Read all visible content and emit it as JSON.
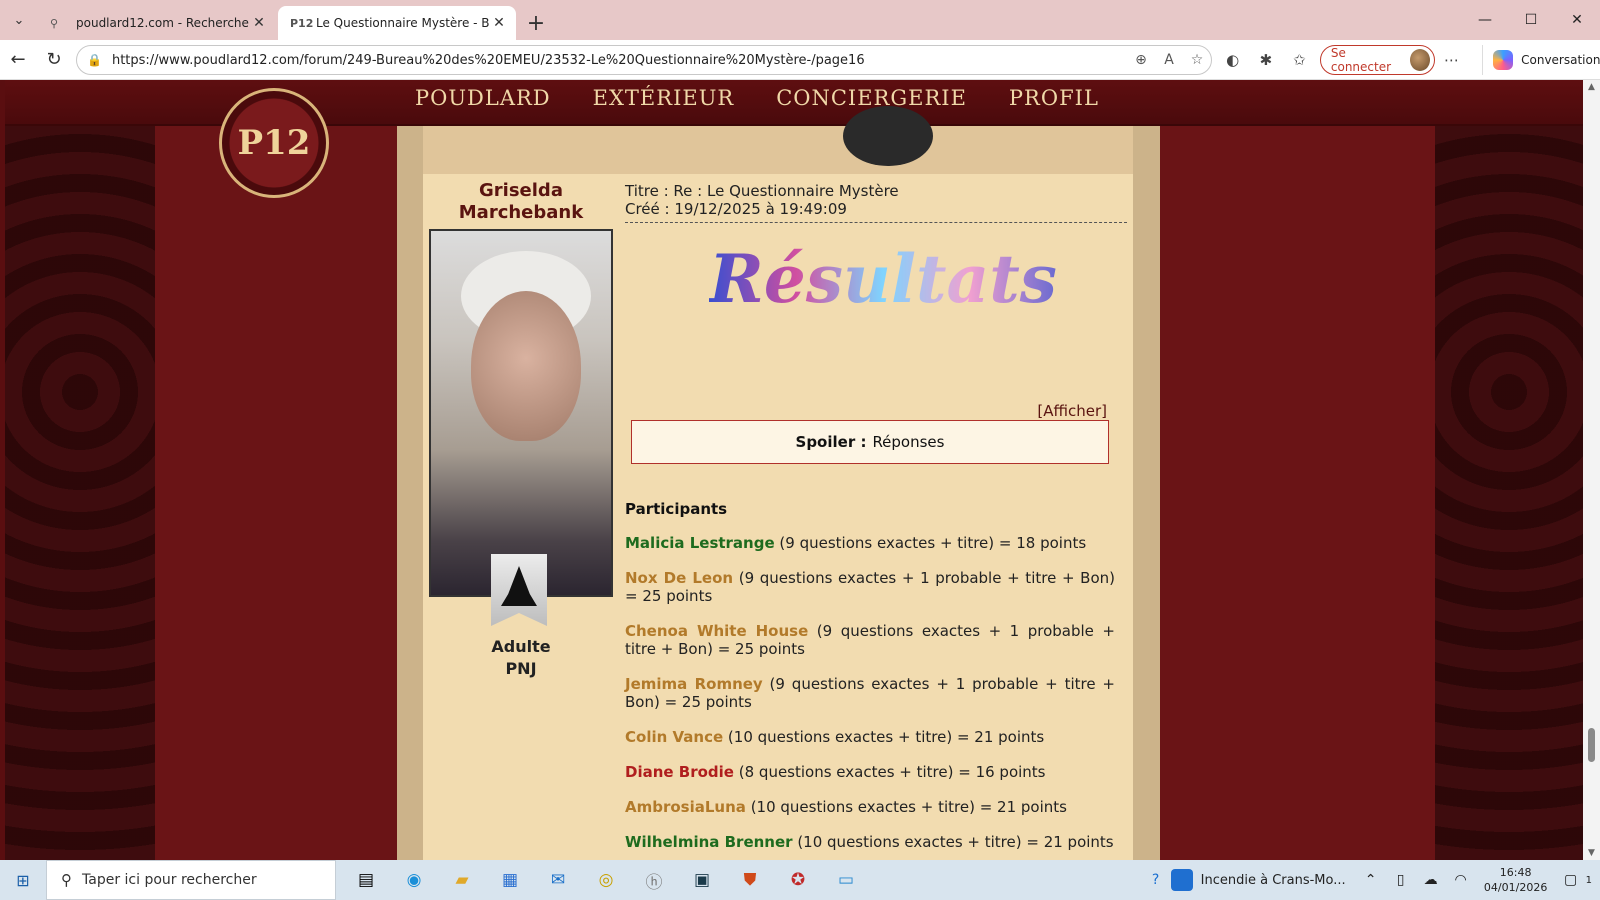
{
  "browser": {
    "tabs": [
      {
        "title": "poudlard12.com - Recherche",
        "active": false,
        "favicon": "search-icon"
      },
      {
        "title": "Le Questionnaire Mystère - Bureau",
        "active": true,
        "favicon_text": "P12"
      }
    ],
    "url": "https://www.poudlard12.com/forum/249-Bureau%20des%20EMEU/23532-Le%20Questionnaire%20Mystère-/page16",
    "login_label": "Se connecter",
    "conversation_label": "Conversation"
  },
  "site": {
    "logo_text": "P12",
    "nav": [
      "POUDLARD",
      "EXTÉRIEUR",
      "CONCIERGERIE",
      "PROFIL"
    ]
  },
  "post": {
    "author_name": "Griselda Marchebank",
    "role_line1": "Adulte",
    "role_line2": "PNJ",
    "title_line": "Titre : Re : Le Questionnaire Mystère",
    "created_line": "Créé : 19/12/2025 à 19:49:09",
    "banner": "Résultats",
    "afficher": "[Afficher]",
    "spoiler_label": "Spoiler :",
    "spoiler_text": "Réponses",
    "participants_title": "Participants",
    "entries": [
      {
        "name": "Malicia Lestrange",
        "text": " (9 questions exactes + titre) = 18 points",
        "color": "#1e6b1e"
      },
      {
        "name": "Nox De Leon",
        "text": " (9 questions exactes + 1 probable + titre + Bon) = 25 points",
        "color": "#b27a2a"
      },
      {
        "name": "Chenoa White House",
        "text": " (9 questions exactes + 1 probable + titre + Bon) = 25 points",
        "color": "#b27a2a"
      },
      {
        "name": "Jemima Romney",
        "text": " (9 questions exactes + 1 probable + titre + Bon) = 25 points",
        "color": "#b27a2a"
      },
      {
        "name": "Colin Vance",
        "text": " (10 questions exactes + titre) = 21 points",
        "color": "#b27a2a"
      },
      {
        "name": "Diane Brodie",
        "text": " (8 questions exactes + titre) = 16 points",
        "color": "#b01e1e"
      },
      {
        "name": "AmbrosiaLuna",
        "text": " (10 questions exactes + titre) = 21 points",
        "color": "#b27a2a"
      },
      {
        "name": "Wilhelmina Brenner",
        "text": " (10 questions exactes + titre) = 21 points",
        "color": "#1e6b1e"
      }
    ]
  },
  "taskbar": {
    "search_placeholder": "Taper ici pour rechercher",
    "news": "Incendie à Crans-Mo...",
    "time": "16:48",
    "date": "04/01/2026",
    "notif_count": "1"
  }
}
